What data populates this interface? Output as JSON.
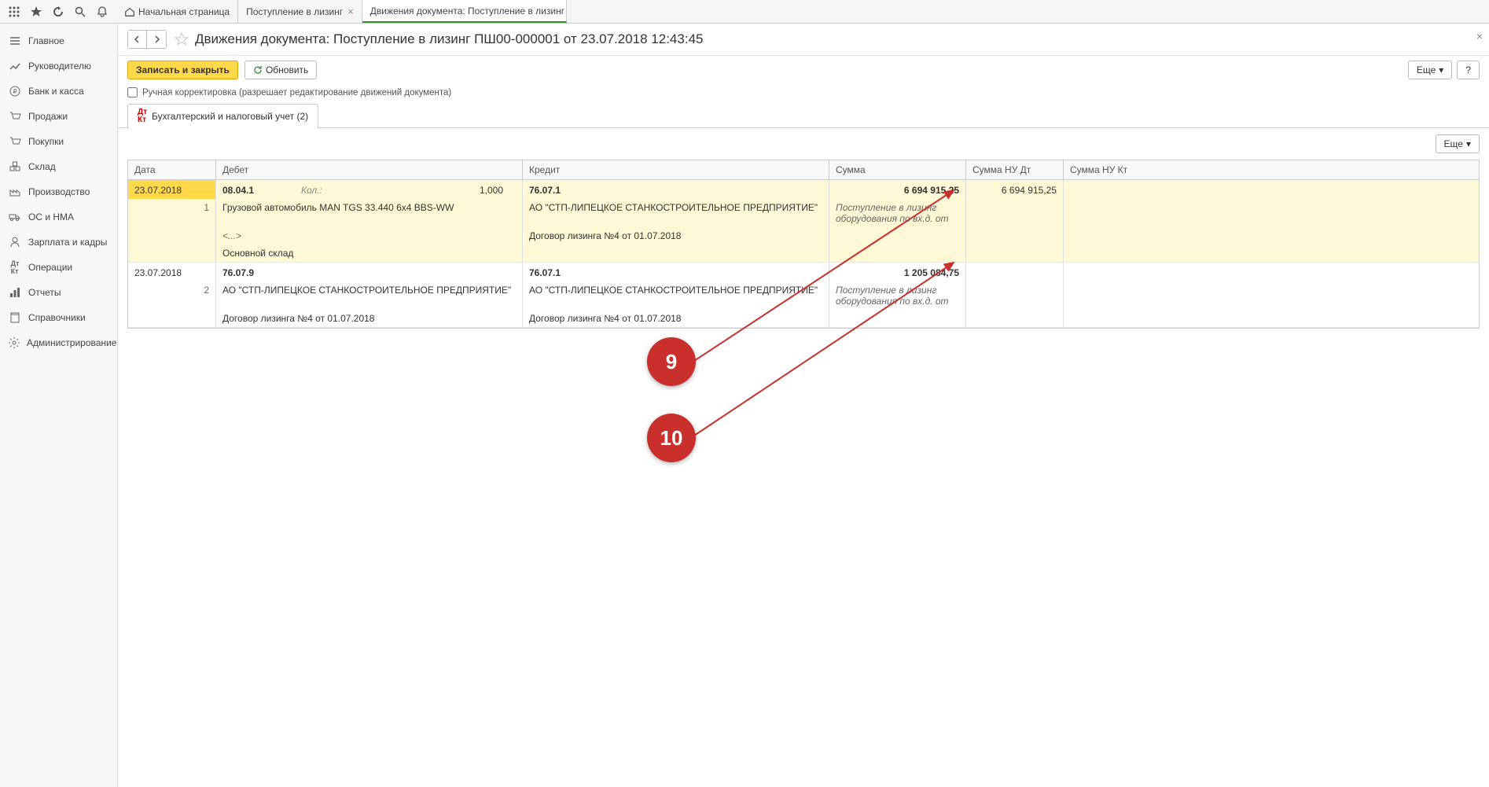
{
  "sys_tabs": [
    {
      "label": "Начальная страница",
      "closable": false
    },
    {
      "label": "Поступление в лизинг",
      "closable": true
    },
    {
      "label": "Движения документа: Поступление в лизинг ПШ00-000001 от 23.07.2018 12:43:45",
      "closable": true,
      "active": true
    }
  ],
  "sidebar": {
    "items": [
      {
        "label": "Главное",
        "icon": "menu"
      },
      {
        "label": "Руководителю",
        "icon": "chart"
      },
      {
        "label": "Банк и касса",
        "icon": "ruble"
      },
      {
        "label": "Продажи",
        "icon": "cart"
      },
      {
        "label": "Покупки",
        "icon": "cart2"
      },
      {
        "label": "Склад",
        "icon": "boxes"
      },
      {
        "label": "Производство",
        "icon": "factory"
      },
      {
        "label": "ОС и НМА",
        "icon": "truck"
      },
      {
        "label": "Зарплата и кадры",
        "icon": "person"
      },
      {
        "label": "Операции",
        "icon": "dtkt"
      },
      {
        "label": "Отчеты",
        "icon": "bars"
      },
      {
        "label": "Справочники",
        "icon": "book"
      },
      {
        "label": "Администрирование",
        "icon": "gear"
      }
    ]
  },
  "page_title": "Движения документа: Поступление в лизинг ПШ00-000001 от 23.07.2018 12:43:45",
  "buttons": {
    "save_close": "Записать и закрыть",
    "refresh": "Обновить",
    "more": "Еще"
  },
  "manual_edit": {
    "label": "Ручная корректировка (разрешает редактирование движений документа)"
  },
  "doc_tab": {
    "label": "Бухгалтерский и налоговый учет (2)"
  },
  "table": {
    "headers": {
      "date": "Дата",
      "debit": "Дебет",
      "credit": "Кредит",
      "sum": "Сумма",
      "nudt": "Сумма НУ Дт",
      "nukt": "Сумма НУ Кт"
    },
    "kol_label": "Кол.:",
    "rows": [
      {
        "highlight": true,
        "date": "23.07.2018",
        "seq": "1",
        "debit_acc": "08.04.1",
        "debit_qty": "1,000",
        "credit_acc": "76.07.1",
        "sum": "6 694 915,25",
        "nudt": "6 694 915,25",
        "debit_l2": "Грузовой автомобиль MAN TGS 33.440 6x4 BBS-WW",
        "credit_l2": "АО \"СТП-ЛИПЕЦКОЕ СТАНКОСТРОИТЕЛЬНОЕ ПРЕДПРИЯТИЕ\"",
        "comment": "Поступление в лизинг оборудования по вх.д.  от",
        "debit_l3": "<...>",
        "credit_l3": "Договор лизинга №4 от 01.07.2018",
        "debit_l4": "Основной склад"
      },
      {
        "highlight": false,
        "date": "23.07.2018",
        "seq": "2",
        "debit_acc": "76.07.9",
        "credit_acc": "76.07.1",
        "sum": "1 205 084,75",
        "debit_l2": "АО \"СТП-ЛИПЕЦКОЕ СТАНКОСТРОИТЕЛЬНОЕ ПРЕДПРИЯТИЕ\"",
        "credit_l2": "АО \"СТП-ЛИПЕЦКОЕ СТАНКОСТРОИТЕЛЬНОЕ ПРЕДПРИЯТИЕ\"",
        "comment": "Поступление в лизинг оборудования по вх.д.  от",
        "debit_l3": "Договор лизинга №4 от 01.07.2018",
        "credit_l3": "Договор лизинга №4 от 01.07.2018"
      }
    ]
  },
  "annotations": [
    {
      "num": "9"
    },
    {
      "num": "10"
    }
  ]
}
